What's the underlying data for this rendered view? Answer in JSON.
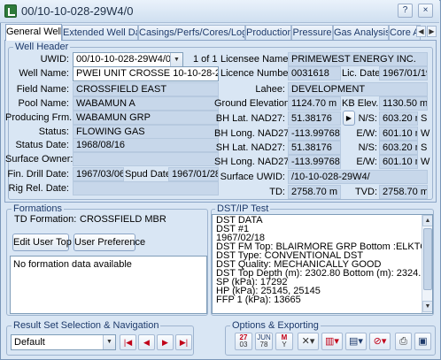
{
  "window": {
    "title": "00/10-10-028-29W4/0"
  },
  "tabs": [
    {
      "label": "General Well",
      "active": true
    },
    {
      "label": "Extended Well Data",
      "active": false
    },
    {
      "label": "Casings/Perfs/Cores/Logs",
      "active": false
    },
    {
      "label": "Production",
      "active": false
    },
    {
      "label": "Pressure",
      "active": false
    },
    {
      "label": "Gas Analysis",
      "active": false
    },
    {
      "label": "Core An",
      "active": false
    }
  ],
  "well_header": {
    "title": "Well Header",
    "uwid_label": "UWID:",
    "uwid_value": "00/10-10-028-29W4/0",
    "page_indicator": "1 of 1",
    "well_name_label": "Well Name:",
    "well_name": "PWEI UNIT CROSSE 10-10-28-29",
    "field_name_label": "Field Name:",
    "field_name": "CROSSFIELD EAST",
    "pool_name_label": "Pool Name:",
    "pool_name": "WABAMUN A",
    "producing_frm_label": "Producing Frm.:",
    "producing_frm": "WABAMUN GRP",
    "status_label": "Status:",
    "status": "FLOWING GAS",
    "status_date_label": "Status Date:",
    "status_date": "1968/08/16",
    "surface_owner_label": "Surface Owner:",
    "surface_owner": "",
    "fin_drill_date_label": "Fin. Drill Date:",
    "fin_drill_date": "1967/03/06",
    "spud_date_label": "Spud Date:",
    "spud_date": "1967/01/28",
    "rig_rel_date_label": "Rig Rel. Date:",
    "rig_rel_date": "",
    "licensee_name_label": "Licensee Name:",
    "licensee_name": "PRIMEWEST ENERGY INC.",
    "licence_number_label": "Licence Number:",
    "licence_number": "0031618",
    "lic_date_label": "Lic. Date:",
    "lic_date": "1967/01/19",
    "lahee_label": "Lahee:",
    "lahee": "DEVELOPMENT",
    "ground_elev_label": "Ground Elevation:",
    "ground_elev": "1124.70 m",
    "kb_elev_label": "KB Elev.:",
    "kb_elev": "1130.50 m",
    "bh_lat_label": "BH Lat. NAD27:",
    "bh_lat": "51.38176",
    "bh_long_label": "BH Long. NAD27:",
    "bh_long": "-113.99768",
    "sh_lat_label": "SH Lat. NAD27:",
    "sh_lat": "51.38176",
    "sh_long_label": "SH Long. NAD27:",
    "sh_long": "-113.99768",
    "ns_label": "N/S:",
    "ns1": "603.20 m",
    "ns1_dir": "S",
    "ew_label": "E/W:",
    "ew1": "601.10 m",
    "ew1_dir": "W",
    "ns2": "603.20 m",
    "ns2_dir": "S",
    "ew2": "601.10 m",
    "ew2_dir": "W",
    "surface_uwid_label": "Surface UWID:",
    "surface_uwid": "/10-10-028-29W4/",
    "td_label": "TD:",
    "td": "2758.70 m",
    "tvd_label": "TVD:",
    "tvd": "2758.70 m"
  },
  "formations": {
    "title": "Formations",
    "td_formation_label": "TD Formation:",
    "td_formation": "CROSSFIELD MBR",
    "edit_user_top": "Edit User Top",
    "user_preference": "User Preference",
    "message": "No formation data available"
  },
  "dst_ip": {
    "title": "DST/IP Test",
    "lines": [
      "DST DATA",
      "DST #1",
      "1967/02/18",
      "DST FM Top: BLAIRMORE GRP          Bottom :ELKTON MBR",
      "DST Type: CONVENTIONAL DST",
      "DST Quality: MECHANICALLY GOOD",
      "DST Top Depth (m): 2302.80          Bottom (m): 2324.10",
      "SP (kPa): 17292",
      "HP (kPa): 25145, 25145",
      "FFP 1 (kPa): 13665"
    ]
  },
  "result_nav": {
    "title": "Result Set Selection & Navigation",
    "selected": "Default",
    "first_icon": "first-record-icon",
    "prev_icon": "previous-record-icon",
    "next_icon": "next-record-icon",
    "last_icon": "last-record-icon"
  },
  "options": {
    "title": "Options & Exporting",
    "cal1_line1": "27",
    "cal1_line2": "03",
    "cal2_line1": "JUN",
    "cal2_line2": "78",
    "cal3_line1": "M",
    "cal3_line2": "Y"
  }
}
